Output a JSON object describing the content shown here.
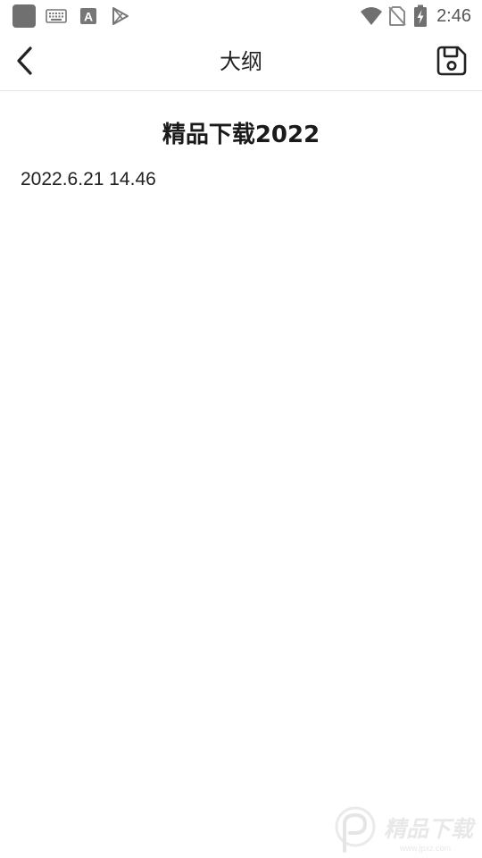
{
  "status_bar": {
    "time": "2:46",
    "icons": [
      "app-square-icon",
      "keyboard-icon",
      "font-a-icon",
      "play-store-icon",
      "wifi-icon",
      "no-sim-icon",
      "battery-charging-icon"
    ],
    "icon_font_letter": "A"
  },
  "app_bar": {
    "title": "大纲",
    "back_icon": "chevron-left-icon",
    "save_icon": "floppy-disk-icon"
  },
  "document": {
    "title": "精品下载2022",
    "meta": "2022.6.21 14.46"
  },
  "watermark": {
    "text": "精品下载",
    "subtext": "www.jpxz.com"
  },
  "colors": {
    "background": "#ffffff",
    "text": "#1a1a1a",
    "status_icons": "#707070",
    "divider": "#e4e4e4"
  }
}
